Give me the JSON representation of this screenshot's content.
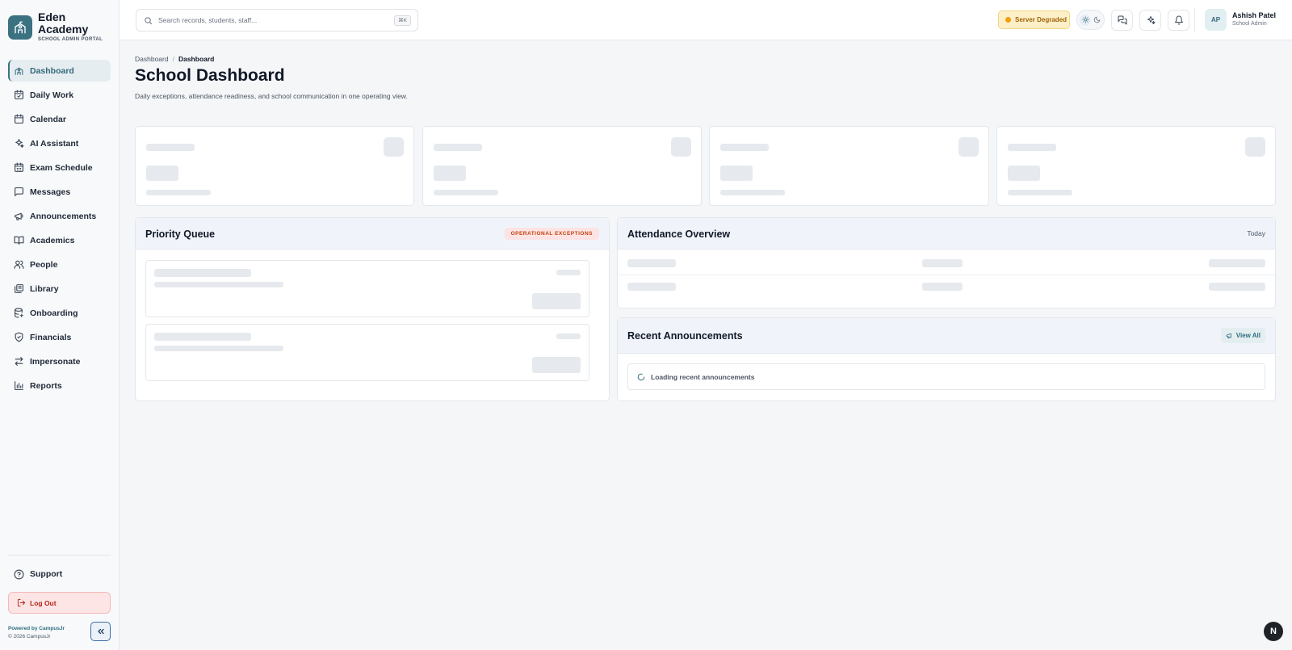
{
  "brand": {
    "name": "Eden Academy",
    "subtitle": "SCHOOL ADMIN PORTAL"
  },
  "sidebar": {
    "items": [
      {
        "label": "Dashboard",
        "icon": "school-icon",
        "active": true
      },
      {
        "label": "Daily Work",
        "icon": "calendar-check-icon"
      },
      {
        "label": "Calendar",
        "icon": "calendar-icon"
      },
      {
        "label": "AI Assistant",
        "icon": "sparkles-icon"
      },
      {
        "label": "Exam Schedule",
        "icon": "calendar-clock-icon"
      },
      {
        "label": "Messages",
        "icon": "message-square-icon"
      },
      {
        "label": "Announcements",
        "icon": "megaphone-icon"
      },
      {
        "label": "Academics",
        "icon": "book-open-icon"
      },
      {
        "label": "People",
        "icon": "users-icon"
      },
      {
        "label": "Library",
        "icon": "library-icon"
      },
      {
        "label": "Onboarding",
        "icon": "database-icon"
      },
      {
        "label": "Financials",
        "icon": "shield-check-icon"
      },
      {
        "label": "Impersonate",
        "icon": "arrows-swap-icon"
      },
      {
        "label": "Reports",
        "icon": "bar-chart-icon"
      }
    ],
    "support_label": "Support",
    "logout_label": "Log Out",
    "powered_by": "Powered by CampusJr",
    "copyright": "© 2026 CampusJr"
  },
  "header": {
    "search_placeholder": "Search records, students, staff...",
    "shortcut": "⌘K",
    "server_status": "Server Degraded",
    "status_color": "#f59e0b",
    "user": {
      "initials": "AP",
      "name": "Ashish Patel",
      "role": "School Admin"
    }
  },
  "main": {
    "breadcrumb": [
      "Dashboard",
      "Dashboard"
    ],
    "title": "School Dashboard",
    "subtitle": "Daily exceptions, attendance readiness, and school communication in one operating view.",
    "priority_queue": {
      "title": "Priority Queue",
      "badge": "OPERATIONAL EXCEPTIONS"
    },
    "attendance": {
      "title": "Attendance Overview",
      "period": "Today"
    },
    "announcements": {
      "title": "Recent Announcements",
      "view_all": "View All",
      "loading": "Loading recent announcements"
    }
  },
  "accent_color": "#3b7281",
  "dev_badge": "N"
}
